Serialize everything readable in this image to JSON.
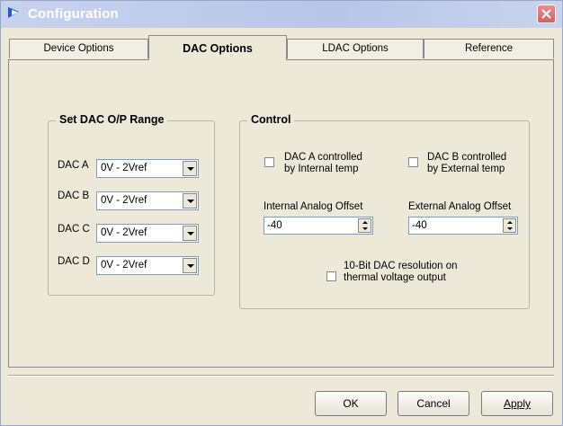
{
  "window": {
    "title": "Configuration"
  },
  "tabs": [
    "Device Options",
    "DAC Options",
    "LDAC Options",
    "Reference"
  ],
  "dac_range": {
    "title": "Set DAC O/P Range",
    "rows": [
      {
        "label": "DAC A",
        "value": "0V - 2Vref"
      },
      {
        "label": "DAC B",
        "value": "0V - 2Vref"
      },
      {
        "label": "DAC C",
        "value": "0V - 2Vref"
      },
      {
        "label": "DAC D",
        "value": "0V - 2Vref"
      }
    ]
  },
  "control": {
    "title": "Control",
    "dac_a_label_1": "DAC A controlled",
    "dac_a_label_2": "by Internal temp",
    "dac_b_label_1": "DAC B controlled",
    "dac_b_label_2": "by External temp",
    "internal_offset_label": "Internal Analog Offset",
    "internal_offset_value": "-40",
    "external_offset_label": "External Analog Offset",
    "external_offset_value": "-40",
    "resolution_label_1": "10-Bit DAC resolution on",
    "resolution_label_2": "thermal voltage output"
  },
  "buttons": {
    "ok": "OK",
    "cancel": "Cancel",
    "apply": "Apply"
  }
}
